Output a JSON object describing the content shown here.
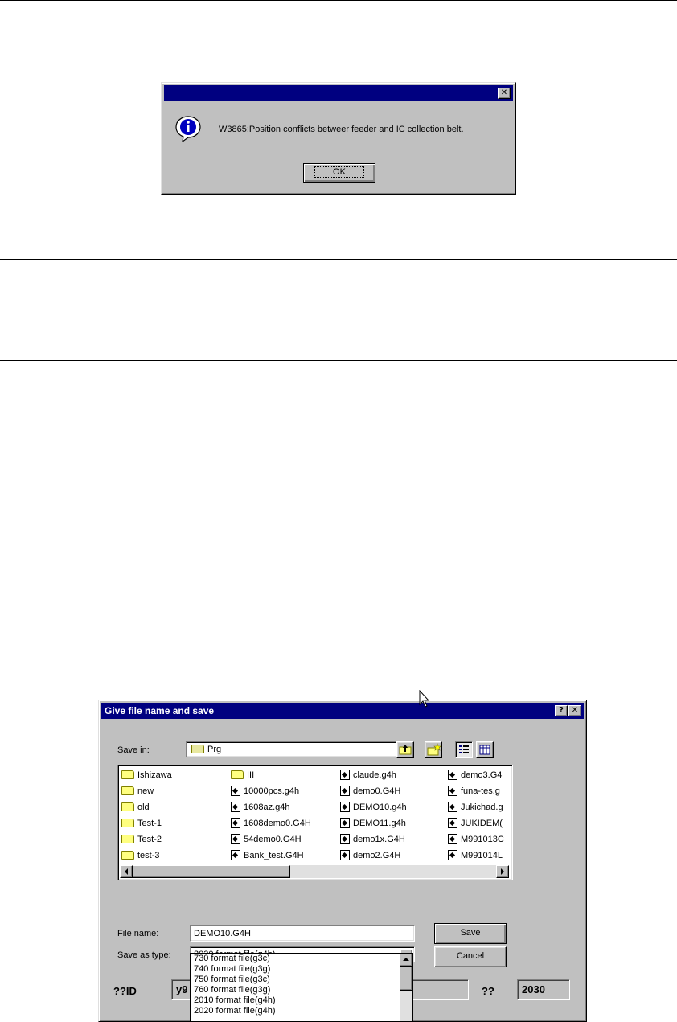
{
  "message_box": {
    "close_glyph": "✕",
    "message": "W3865:Position conflicts betweer feeder and IC collection belt.",
    "ok_label": "OK",
    "icon": "info-icon"
  },
  "save_dialog": {
    "title": "Give file name and save",
    "help_glyph": "?",
    "close_glyph": "✕",
    "save_in_label": "Save in:",
    "save_in_value": "Prg",
    "toolbar_icons": [
      "up-folder-icon",
      "new-folder-icon",
      "list-view-icon",
      "details-view-icon"
    ],
    "files": [
      {
        "name": "Ishizawa",
        "type": "folder"
      },
      {
        "name": "new",
        "type": "folder"
      },
      {
        "name": "old",
        "type": "folder"
      },
      {
        "name": "Test-1",
        "type": "folder"
      },
      {
        "name": "Test-2",
        "type": "folder"
      },
      {
        "name": "test-3",
        "type": "folder"
      },
      {
        "name": "III",
        "type": "folder"
      },
      {
        "name": "10000pcs.g4h",
        "type": "file"
      },
      {
        "name": "1608az.g4h",
        "type": "file"
      },
      {
        "name": "1608demo0.G4H",
        "type": "file"
      },
      {
        "name": "54demo0.G4H",
        "type": "file"
      },
      {
        "name": "Bank_test.G4H",
        "type": "file"
      },
      {
        "name": "claude.g4h",
        "type": "file"
      },
      {
        "name": "demo0.G4H",
        "type": "file"
      },
      {
        "name": "DEMO10.g4h",
        "type": "file"
      },
      {
        "name": "DEMO11.g4h",
        "type": "file"
      },
      {
        "name": "demo1x.G4H",
        "type": "file"
      },
      {
        "name": "demo2.G4H",
        "type": "file"
      },
      {
        "name": "demo3.G4",
        "type": "file"
      },
      {
        "name": "funa-tes.g",
        "type": "file"
      },
      {
        "name": "Jukichad.g",
        "type": "file"
      },
      {
        "name": "JUKIDEM(",
        "type": "file"
      },
      {
        "name": "M991013C",
        "type": "file"
      },
      {
        "name": "M991014L",
        "type": "file"
      }
    ],
    "file_name_label": "File name:",
    "file_name_value": "DEMO10.G4H",
    "save_as_type_label": "Save as type:",
    "save_as_type_value": "2030 format file(g4h)",
    "save_button": "Save",
    "cancel_button": "Cancel",
    "type_options": [
      "730 format file(g3c)",
      "740 format file(g3g)",
      "750 format file(g3c)",
      "760 format file(g3g)",
      "2010 format file(g4h)",
      "2020 format file(g4h)"
    ],
    "id_label": "??ID",
    "id_value": "y9",
    "model_label": "??",
    "model_value": "2030"
  }
}
